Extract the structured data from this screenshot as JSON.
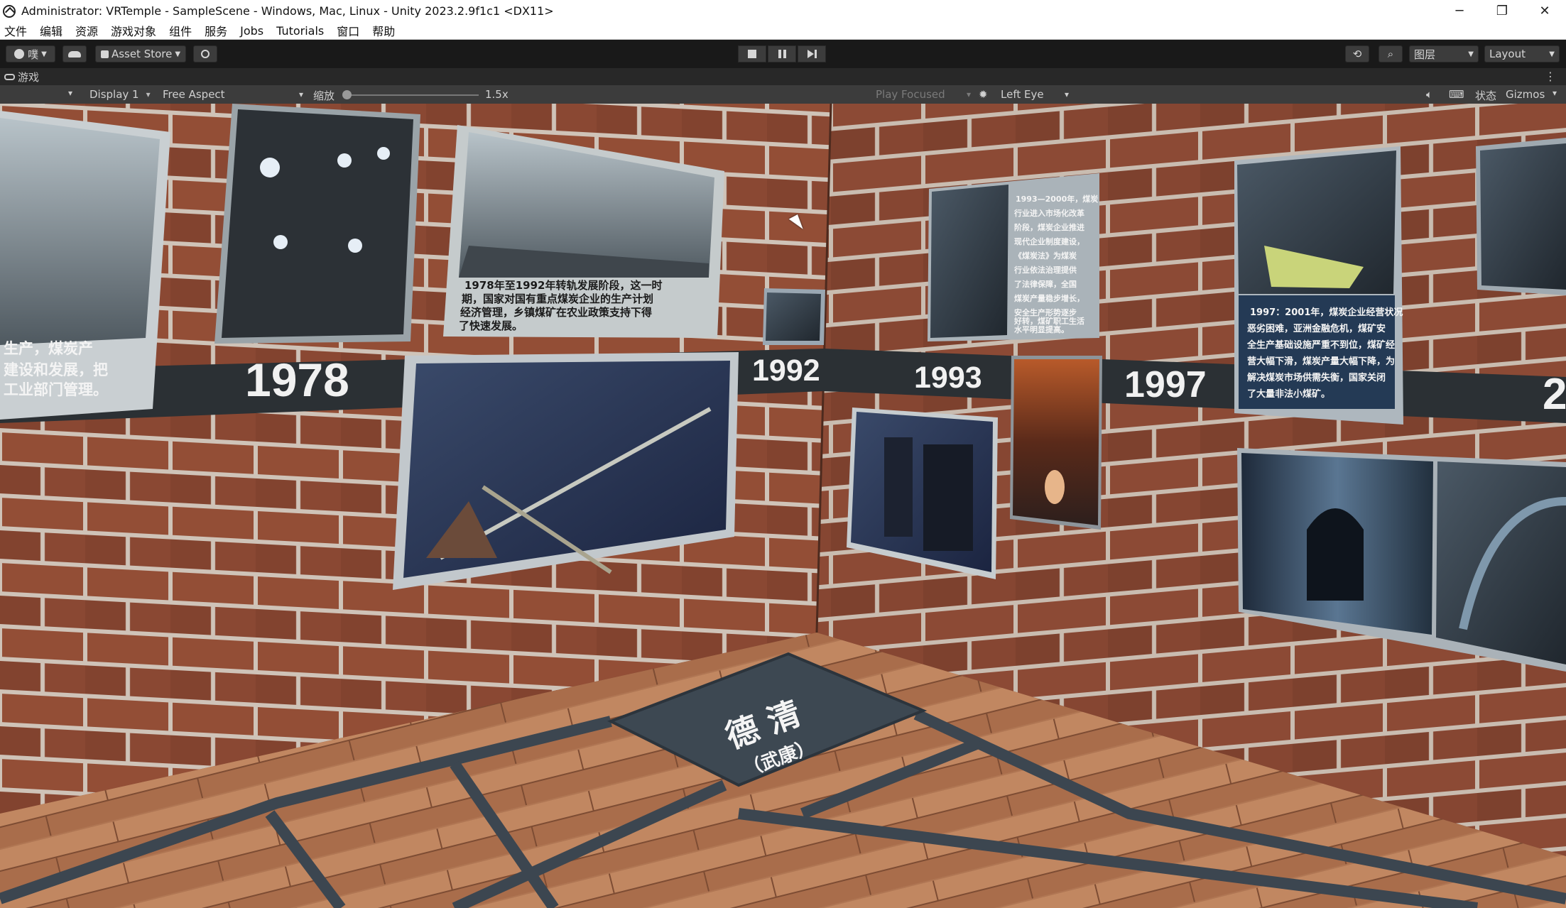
{
  "window": {
    "title": "Administrator: VRTemple - SampleScene - Windows, Mac, Linux - Unity 2023.2.9f1c1 <DX11>",
    "minimize": "─",
    "restore": "❐",
    "close": "✕"
  },
  "menu": [
    "文件",
    "编辑",
    "资源",
    "游戏对象",
    "组件",
    "服务",
    "Jobs",
    "Tutorials",
    "窗口",
    "帮助"
  ],
  "toolbar": {
    "account_label": "噗",
    "asset_store": "Asset Store",
    "layers": "图层",
    "layout": "Layout"
  },
  "game_tab": {
    "label": "游戏"
  },
  "game_bar": {
    "display": "Display 1",
    "aspect": "Free Aspect",
    "scale_label": "缩放",
    "scale_value": "1.5x",
    "scale_fraction": 0.0,
    "play_mode": "Play Focused",
    "eye": "Left Eye",
    "stats": "状态",
    "gizmos": "Gizmos"
  },
  "scene": {
    "years": [
      "1978",
      "1992",
      "1993",
      "1997",
      "2"
    ],
    "caption_left": [
      "生产，煤炭产",
      "建设和发展，把",
      "工业部门管理。"
    ],
    "caption_1978": [
      "1978年至1992年转轨发展阶段，这一时",
      "期，国家对国有重点煤炭企业的生产计划",
      "经济管理，乡镇煤矿在农业政策支持下得",
      "了快速发展。"
    ],
    "caption_1993": [
      "1993—2000年，煤炭",
      "行业进入市场化改革",
      "阶段，煤炭企业推进",
      "现代企业制度建设，",
      "《煤炭法》为煤炭",
      "行业依法治理提供",
      "了法律保障，全国",
      "煤炭产量稳步增长，",
      "安全生产形势逐步",
      "好转，煤矿职工生活",
      "水平明显提高。"
    ],
    "caption_1997": [
      "1997：2001年，煤炭企业经营状况",
      "恶劣困难，亚洲金融危机，煤矿安",
      "全生产基础设施严重不到位，煤矿经",
      "营大幅下滑，煤炭产量大幅下降，为",
      "解决煤炭市场供需失衡，国家关闭",
      "了大量非法小煤矿。"
    ],
    "floor_sign_main": "德 清",
    "floor_sign_sub": "（武康）"
  },
  "colors": {
    "titlebar_bg": "#ffffff",
    "editor_bg": "#191919",
    "toolbar_bg": "#3c3c3c",
    "brick": "#8a4a33",
    "year_band": "#2c3135",
    "floor": "#a86f4d"
  }
}
